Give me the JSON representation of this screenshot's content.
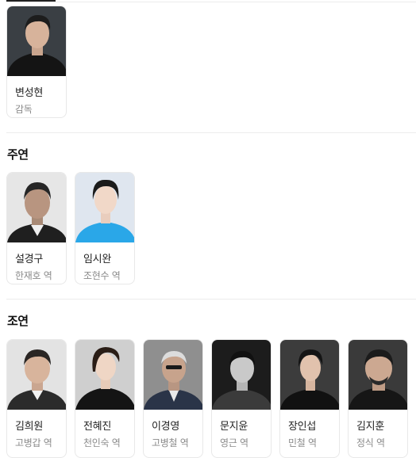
{
  "director": {
    "people": [
      {
        "name": "변성현",
        "role": "감독"
      }
    ]
  },
  "lead": {
    "title": "주연",
    "people": [
      {
        "name": "설경구",
        "role": "한재호 역"
      },
      {
        "name": "임시완",
        "role": "조현수 역"
      }
    ]
  },
  "supporting": {
    "title": "조연",
    "people": [
      {
        "name": "김희원",
        "role": "고병갑 역"
      },
      {
        "name": "전혜진",
        "role": "천인숙 역"
      },
      {
        "name": "이경영",
        "role": "고병철 역"
      },
      {
        "name": "문지윤",
        "role": "영근 역"
      },
      {
        "name": "장인섭",
        "role": "민철 역"
      },
      {
        "name": "김지훈",
        "role": "정식 역"
      }
    ]
  }
}
